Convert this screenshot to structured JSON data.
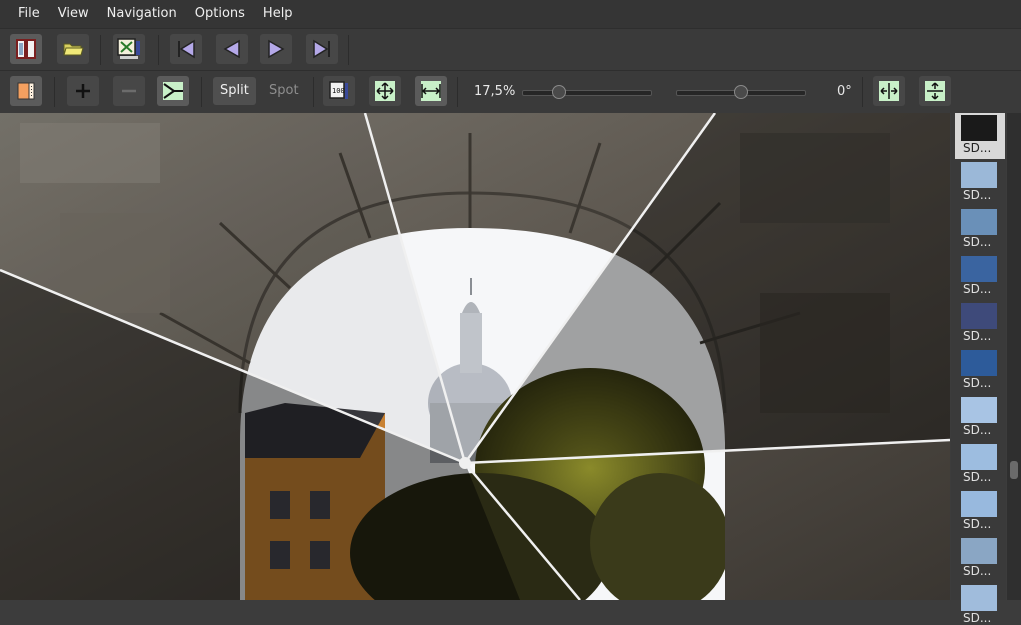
{
  "menu": [
    "File",
    "View",
    "Navigation",
    "Options",
    "Help"
  ],
  "toolbar2": {
    "split_label": "Split",
    "spot_label": "Spot",
    "zoom_value": "17,5%",
    "rotation_value": "0°",
    "zoom_slider_fraction": 0.25,
    "rotation_slider_fraction": 0.5
  },
  "thumbnails": [
    {
      "label": "SD...",
      "tone": "#1a1a1a",
      "selected": true
    },
    {
      "label": "SD...",
      "tone": "#9bb8d8"
    },
    {
      "label": "SD...",
      "tone": "#6a90b8"
    },
    {
      "label": "SD...",
      "tone": "#3a64a0"
    },
    {
      "label": "SD...",
      "tone": "#3e4a7a"
    },
    {
      "label": "SD...",
      "tone": "#2d5b9a"
    },
    {
      "label": "SD...",
      "tone": "#a8c4e4"
    },
    {
      "label": "SD...",
      "tone": "#9dbde0"
    },
    {
      "label": "SD...",
      "tone": "#98b9de"
    },
    {
      "label": "SD...",
      "tone": "#8aa6c4"
    },
    {
      "label": "SD...",
      "tone": "#a0bcdc"
    }
  ],
  "colors": {
    "background": "#3c3c3c",
    "toolbar": "#3a3a3a",
    "icon_green": "#c8f0c8",
    "icon_purple": "#b4a8e8",
    "icon_orange": "#f4a060"
  }
}
